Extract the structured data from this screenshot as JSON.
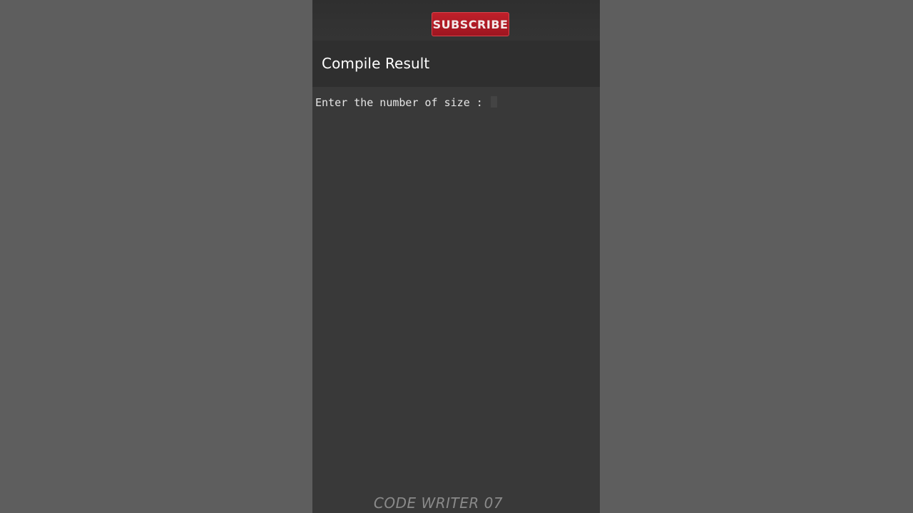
{
  "header": {
    "subscribe_label": "SUBSCRIBE"
  },
  "app_bar": {
    "title": "Compile Result"
  },
  "console": {
    "output_text": "Enter the number of size : "
  },
  "watermark": {
    "text": "CODE WRITER 07"
  },
  "colors": {
    "page_background": "#5e5e5e",
    "screen_background": "#393939",
    "app_bar_background": "#2f2f2f",
    "subscribe_red": "#b51c26"
  }
}
